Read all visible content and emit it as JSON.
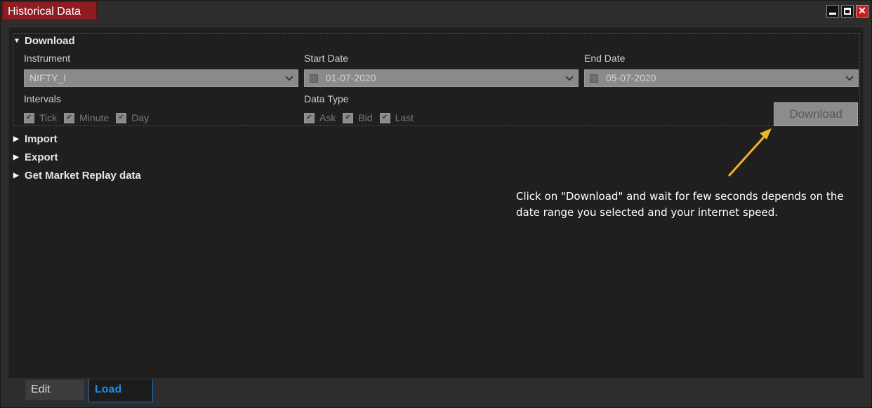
{
  "window": {
    "title": "Historical Data",
    "close_glyph": "✕"
  },
  "sections": {
    "download": {
      "label": "Download",
      "instrument_label": "Instrument",
      "instrument_value": "NIFTY_I",
      "start_date_label": "Start Date",
      "start_date_value": "01-07-2020",
      "end_date_label": "End Date",
      "end_date_value": "05-07-2020",
      "intervals_label": "Intervals",
      "intervals": [
        "Tick",
        "Minute",
        "Day"
      ],
      "data_type_label": "Data Type",
      "data_types": [
        "Ask",
        "Bid",
        "Last"
      ],
      "download_button": "Download"
    },
    "import": {
      "label": "Import"
    },
    "export": {
      "label": "Export"
    },
    "market_replay": {
      "label": "Get Market Replay data"
    }
  },
  "annotation": {
    "text": "Click on \"Download\" and wait for few seconds depends on the date range you selected and your internet speed.",
    "arrow_color": "#f0b429"
  },
  "tabs": {
    "edit": "Edit",
    "load": "Load"
  },
  "colors": {
    "title_bg": "#8e1d22",
    "active_tab": "#1e8ae0",
    "panel_bg": "#1f1f1f"
  },
  "icons": {
    "expanded": "triangle-down-icon",
    "collapsed": "triangle-right-icon",
    "calendar": "calendar-icon",
    "dropdown": "chevron-down-icon"
  }
}
